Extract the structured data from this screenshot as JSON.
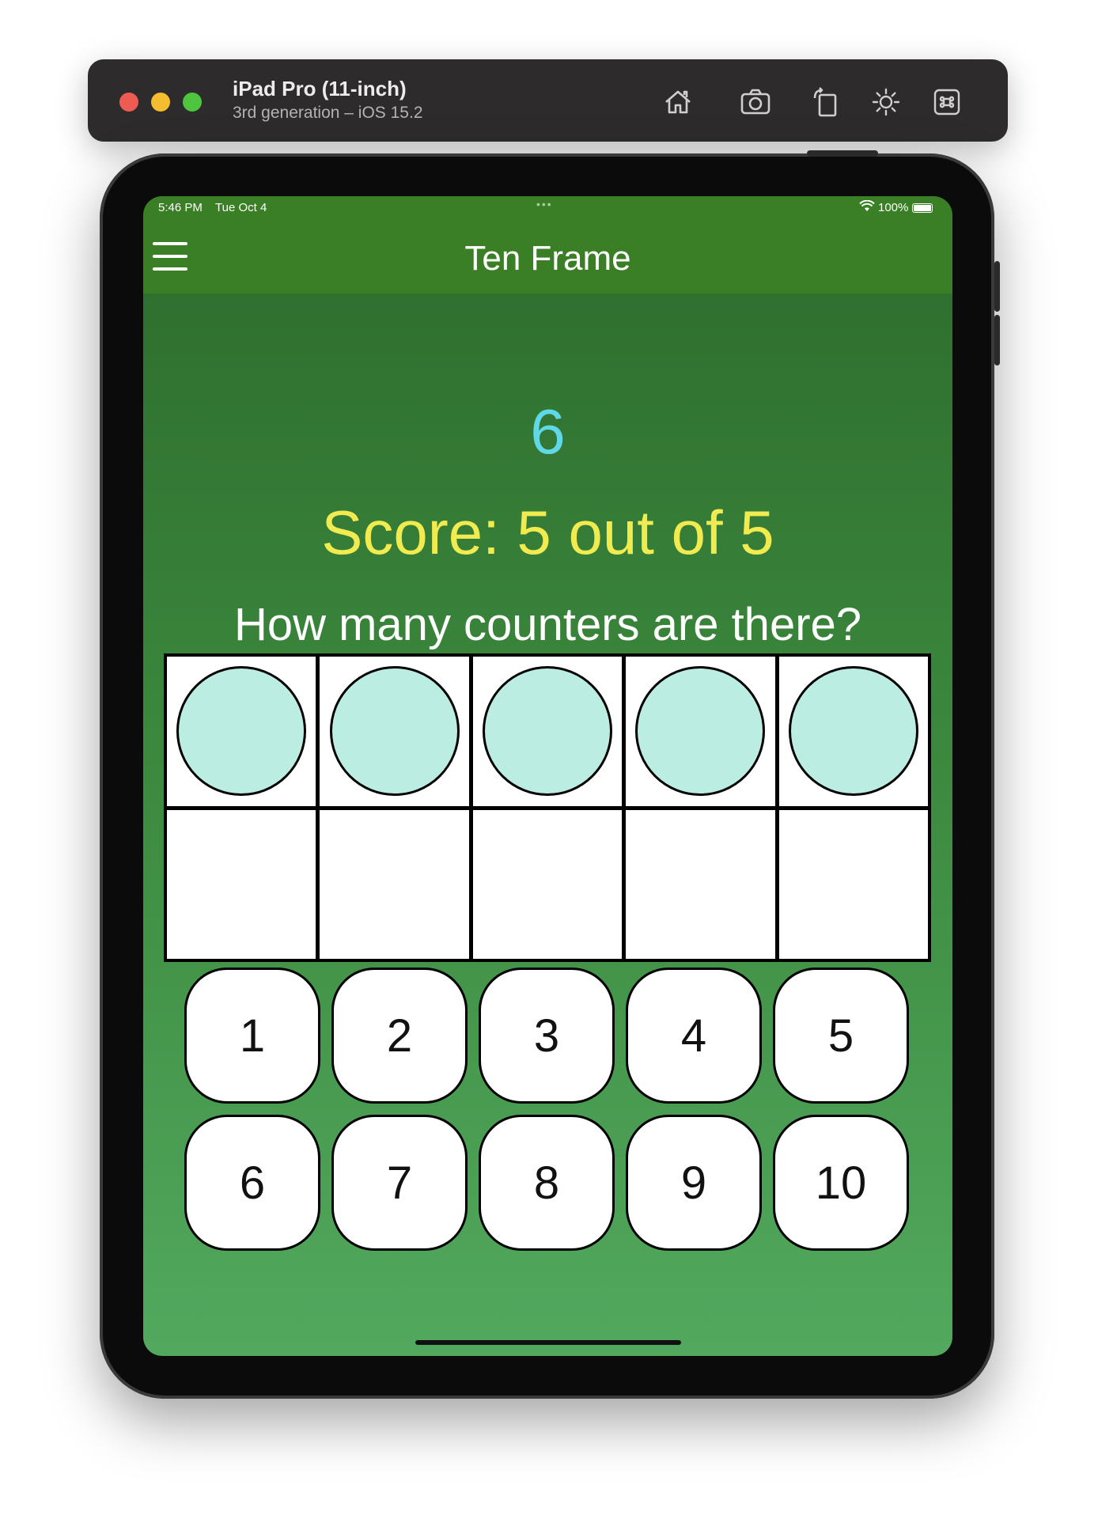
{
  "simulator": {
    "device_name": "iPad Pro (11-inch)",
    "device_detail": "3rd generation – iOS 15.2",
    "tools": [
      "home-icon",
      "screenshot-icon",
      "rotate-icon",
      "appearance-icon",
      "command-icon"
    ]
  },
  "status_bar": {
    "time": "5:46 PM",
    "date": "Tue Oct 4",
    "battery": "100%"
  },
  "navbar": {
    "title": "Ten Frame"
  },
  "game": {
    "target_number": "6",
    "score": "Score: 5 out of 5",
    "question": "How many counters are there?",
    "ten_frame": {
      "filled_cells": [
        true,
        true,
        true,
        true,
        true,
        false,
        false,
        false,
        false,
        false
      ],
      "counter_color": "#bbede3"
    },
    "answers": [
      "1",
      "2",
      "3",
      "4",
      "5",
      "6",
      "7",
      "8",
      "9",
      "10"
    ]
  },
  "colors": {
    "navbar": "#3a7f25",
    "target_number": "#5fd9e8",
    "score": "#f2eb4f"
  }
}
